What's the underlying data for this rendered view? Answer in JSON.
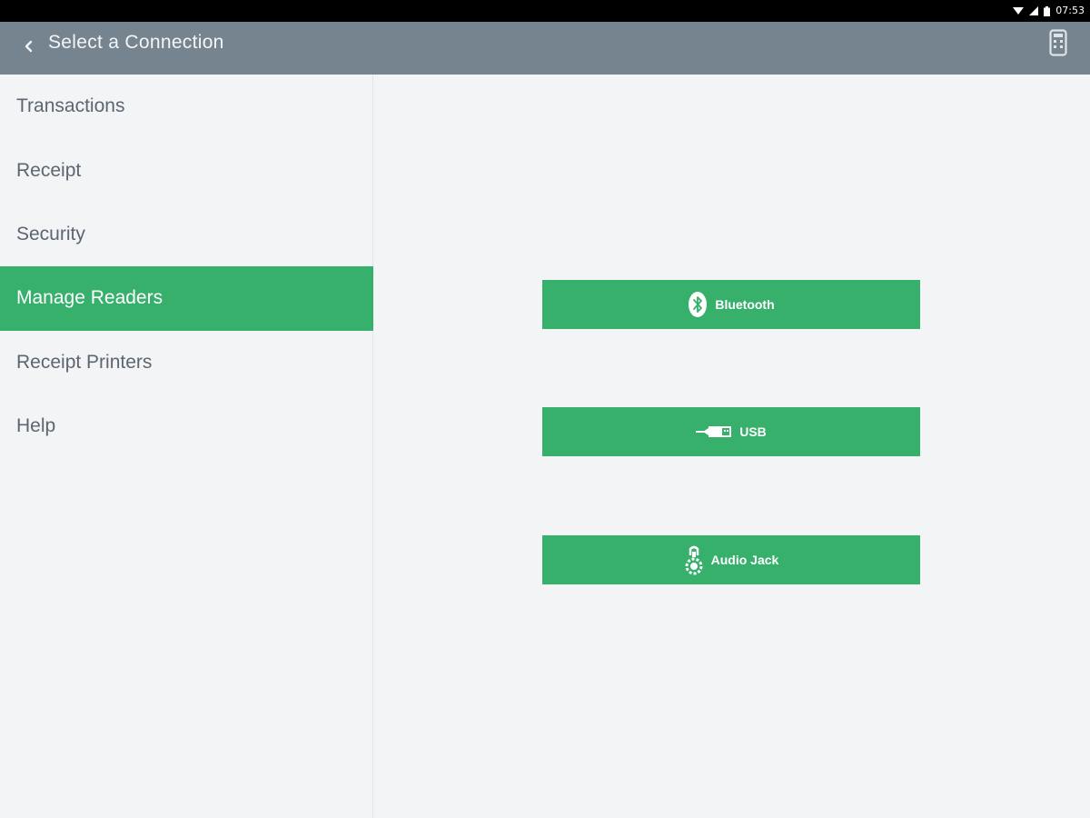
{
  "status_bar": {
    "time": "07:53",
    "icons": [
      "wifi-icon",
      "signal-icon",
      "battery-icon"
    ]
  },
  "app_bar": {
    "title": "Select a Connection",
    "back_icon": "back-chevron-icon",
    "reader_icon": "card-reader-icon"
  },
  "sidebar": {
    "items": [
      {
        "label": "Transactions",
        "active": false
      },
      {
        "label": "Receipt",
        "active": false
      },
      {
        "label": "Security",
        "active": false
      },
      {
        "label": "Manage Readers",
        "active": true
      },
      {
        "label": "Receipt Printers",
        "active": false
      },
      {
        "label": "Help",
        "active": false
      }
    ]
  },
  "connections": [
    {
      "label": "Bluetooth",
      "icon": "bluetooth-icon"
    },
    {
      "label": "USB",
      "icon": "usb-icon"
    },
    {
      "label": "Audio Jack",
      "icon": "audio-jack-icon"
    }
  ],
  "colors": {
    "accent": "#36b06b",
    "app_bar": "#76848f",
    "background": "#f2f4f6",
    "sidebar_text": "#5d6670"
  }
}
